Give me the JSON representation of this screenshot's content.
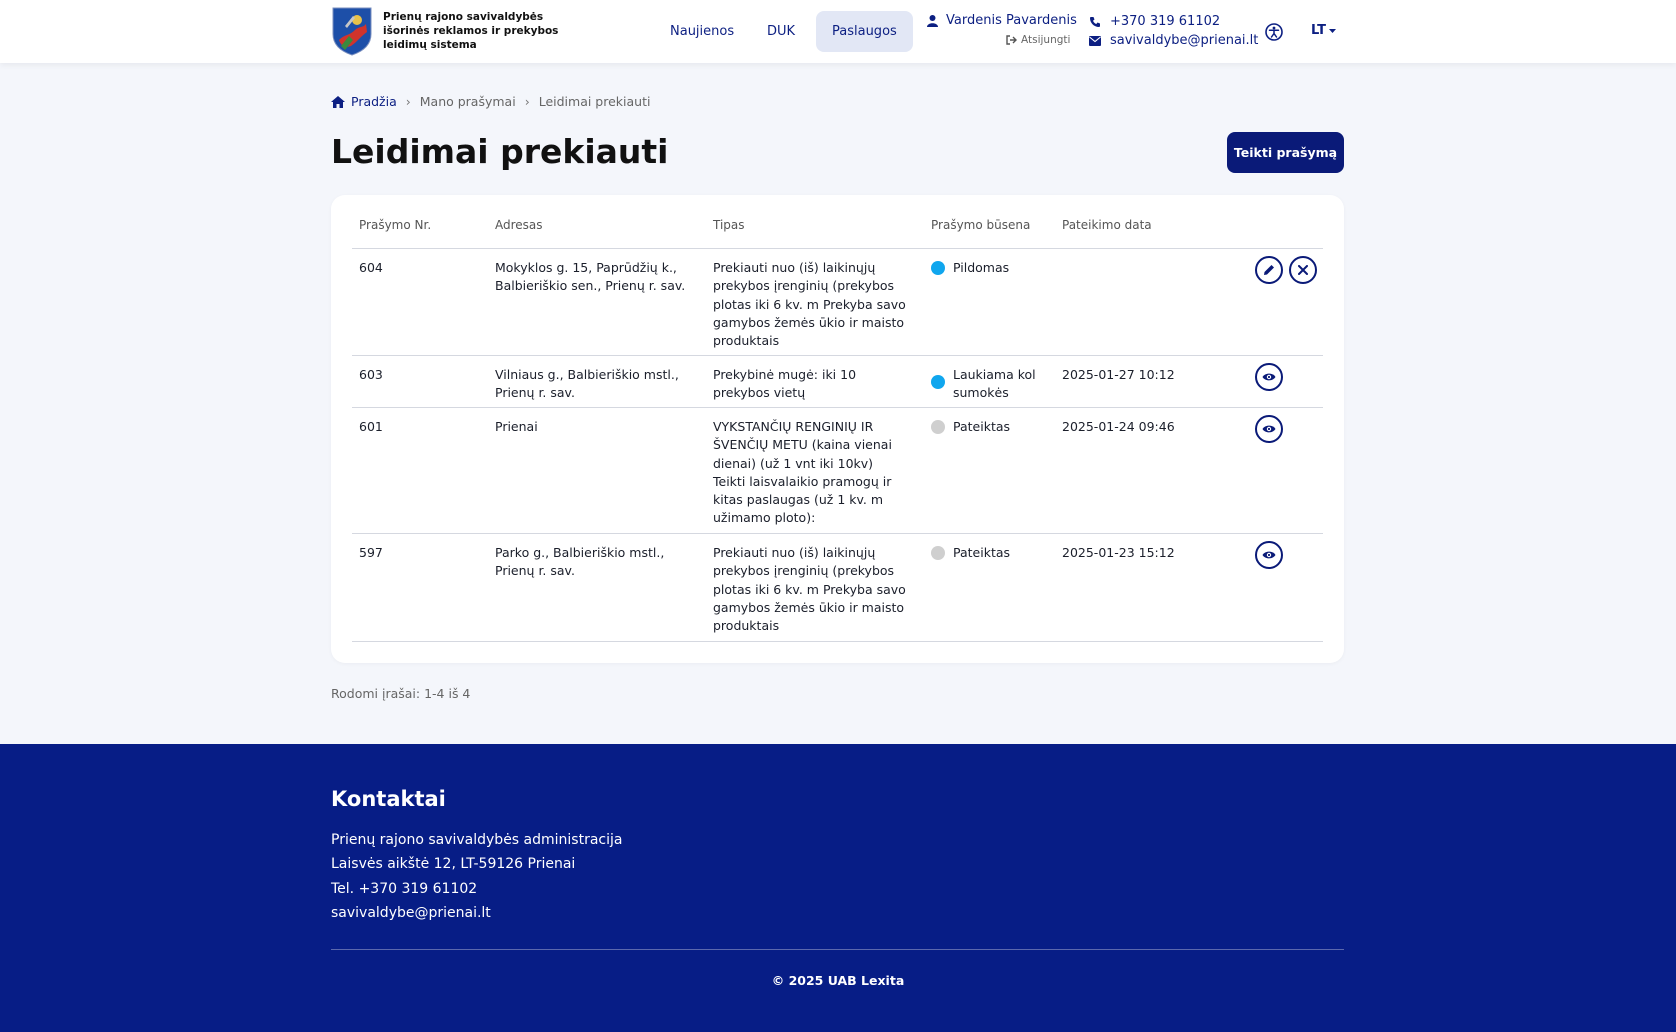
{
  "header": {
    "brand_text": "Prienų rajono savivaldybės išorinės reklamos ir prekybos leidimų sistema",
    "nav": [
      {
        "label": "Naujienos"
      },
      {
        "label": "DUK"
      },
      {
        "label": "Paslaugos"
      }
    ],
    "user": {
      "name": "Vardenis Pavardenis",
      "logout": "Atsijungti"
    },
    "phone": "+370 319 61102",
    "email": "savivaldybe@prienai.lt",
    "language": "LT",
    "accent_color": "#0a1a78"
  },
  "breadcrumb": {
    "home": "Pradžia",
    "items": [
      "Mano prašymai",
      "Leidimai prekiauti"
    ]
  },
  "page": {
    "title": "Leidimai prekiauti",
    "submit_button": "Teikti prašymą"
  },
  "table": {
    "headers": {
      "number": "Prašymo Nr.",
      "address": "Adresas",
      "type": "Tipas",
      "status": "Prašymo būsena",
      "date": "Pateikimo data"
    },
    "rows": [
      {
        "number": "604",
        "address": "Mokyklos g. 15, Paprūdžių k., Balbieriškio sen., Prienų r. sav.",
        "type": "Prekiauti nuo (iš) laikinųjų prekybos įrenginių (prekybos plotas iki 6 kv. m Prekyba savo gamybos žemės ūkio ir maisto produktais",
        "status": "Pildomas",
        "status_color": "blue",
        "date": "",
        "actions": [
          "pencil-icon",
          "close-icon"
        ]
      },
      {
        "number": "603",
        "address": "Vilniaus g., Balbieriškio mstl., Prienų r. sav.",
        "type": "Prekybinė mugė: iki 10 prekybos vietų",
        "status": "Laukiama kol sumokės",
        "status_color": "blue",
        "date": "2025-01-27 10:12",
        "actions": [
          "eye-icon"
        ]
      },
      {
        "number": "601",
        "address": "Prienai",
        "type": "VYKSTANČIŲ RENGINIŲ IR ŠVENČIŲ METU (kaina vienai dienai) (už 1 vnt iki 10kv) Teikti laisvalaikio pramogų ir kitas paslaugas (už 1 kv. m užimamo ploto):",
        "status": "Pateiktas",
        "status_color": "gray",
        "date": "2025-01-24 09:46",
        "actions": [
          "eye-icon"
        ]
      },
      {
        "number": "597",
        "address": "Parko g., Balbieriškio mstl., Prienų r. sav.",
        "type": "Prekiauti nuo (iš) laikinųjų prekybos įrenginių (prekybos plotas iki 6 kv. m Prekyba savo gamybos žemės ūkio ir maisto produktais",
        "status": "Pateiktas",
        "status_color": "gray",
        "date": "2025-01-23 15:12",
        "actions": [
          "eye-icon"
        ]
      }
    ],
    "records_text": "Rodomi įrašai: 1-4 iš 4"
  },
  "footer": {
    "title": "Kontaktai",
    "lines": [
      "Prienų rajono savivaldybės administracija",
      "Laisvės aikštė 12, LT-59126 Prienai",
      "Tel. +370 319 61102",
      "savivaldybe@prienai.lt"
    ],
    "copyright": "© 2025 UAB Lexita",
    "background_color": "#071d86"
  }
}
